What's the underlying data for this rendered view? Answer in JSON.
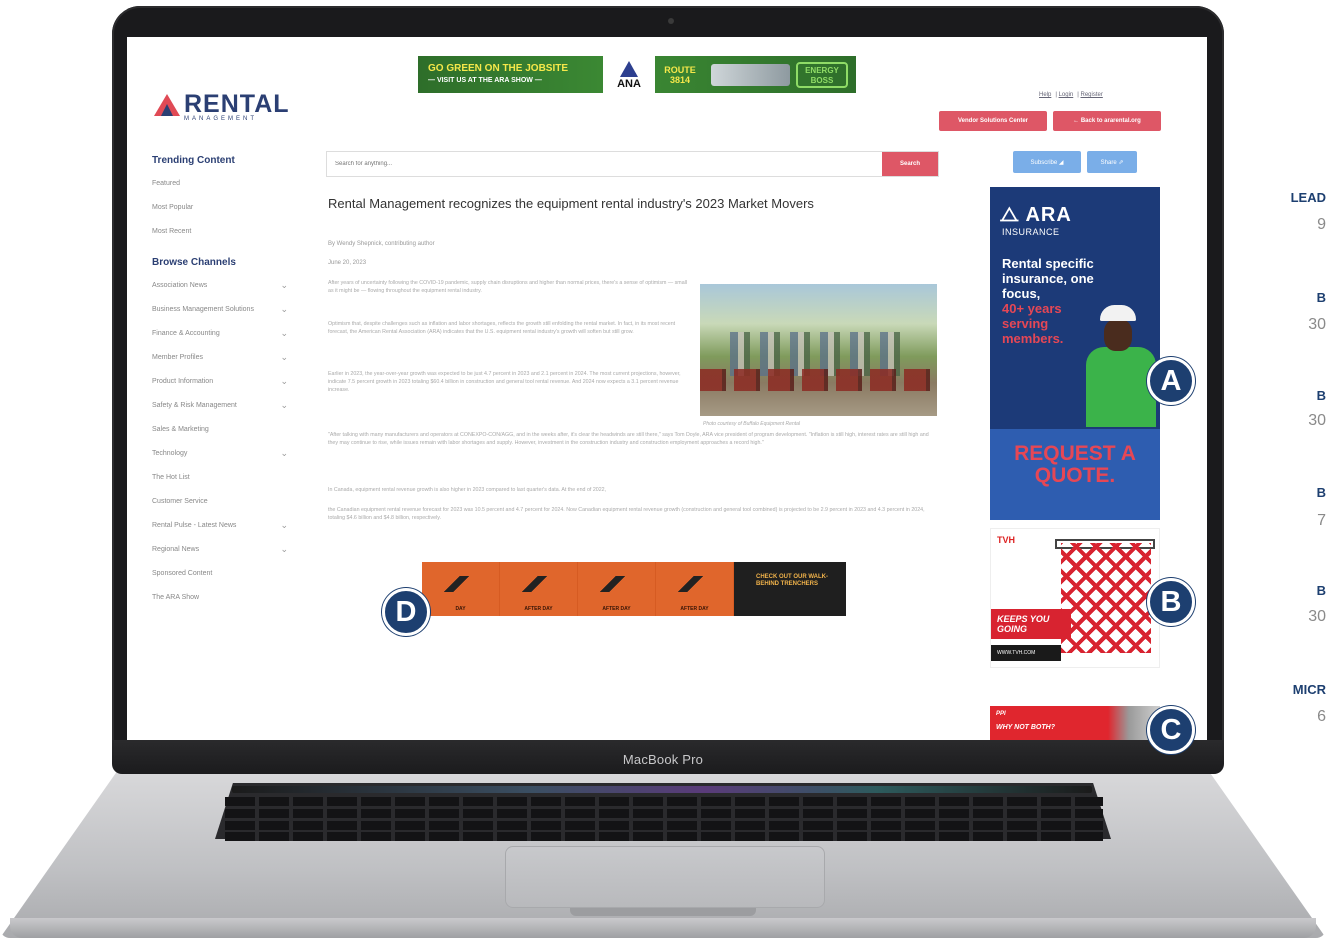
{
  "laptop": {
    "brand_label": "MacBook Pro"
  },
  "site": {
    "top_banner": {
      "headline": "GO GREEN ON THE JOBSITE",
      "subline": "— VISIT US AT THE ARA SHOW —",
      "ana": "ANA",
      "route": "ROUTE 3814",
      "boss": "ENERGY BOSS"
    },
    "logo": {
      "name": "RENTAL",
      "sub": "MANAGEMENT"
    },
    "top_links": [
      "Help",
      "Login",
      "Register"
    ],
    "vendor_button": "Vendor Solutions Center",
    "back_button": "← Back to ararental.org",
    "search": {
      "placeholder": "Search for anything...",
      "button": "Search"
    },
    "subscribe_button": "Subscribe ◢",
    "share_button": "Share ⇗",
    "sidebar": {
      "trending_heading": "Trending Content",
      "trending": [
        "Featured",
        "Most Popular",
        "Most Recent"
      ],
      "browse_heading": "Browse Channels",
      "channels": [
        {
          "label": "Association News",
          "chevron": true
        },
        {
          "label": "Business Management Solutions",
          "chevron": true
        },
        {
          "label": "Finance & Accounting",
          "chevron": true
        },
        {
          "label": "Member Profiles",
          "chevron": true
        },
        {
          "label": "Product Information",
          "chevron": true
        },
        {
          "label": "Safety & Risk Management",
          "chevron": true
        },
        {
          "label": "Sales & Marketing",
          "chevron": false
        },
        {
          "label": "Technology",
          "chevron": true
        },
        {
          "label": "The Hot List",
          "chevron": false
        },
        {
          "label": "Customer Service",
          "chevron": false
        },
        {
          "label": "Rental Pulse - Latest News",
          "chevron": true
        },
        {
          "label": "Regional News",
          "chevron": true
        },
        {
          "label": "Sponsored Content",
          "chevron": false
        },
        {
          "label": "The ARA Show",
          "chevron": false
        }
      ]
    },
    "article": {
      "title": "Rental Management recognizes the equipment rental industry's 2023 Market Movers",
      "byline": "By Wendy Shepnick, contributing author",
      "date": "June 20, 2023",
      "paragraphs": [
        "After years of uncertainty following the COVID-19 pandemic, supply chain disruptions and higher than normal prices, there's a sense of optimism — small as it might be — flowing throughout the equipment rental industry.",
        "Optimism that, despite challenges such as inflation and labor shortages, reflects the growth still enfolding the rental market. In fact, in its most recent forecast, the American Rental Association (ARA) indicates that the U.S. equipment rental industry's growth will soften but still grow.",
        "Earlier in 2023, the year-over-year growth was expected to be just 4.7 percent in 2023 and 2.1 percent in 2024. The most current projections, however, indicate 7.5 percent growth in 2023 totaling $60.4 billion in construction and general tool rental revenue. And 2024 now expects a 3.1 percent revenue increase.",
        "\"After talking with many manufacturers and operators at CONEXPO-CON/AGG, and in the weeks after, it's clear the headwinds are still there,\" says Tom Doyle, ARA vice president of program development. \"Inflation is still high, interest rates are still high and they may continue to rise, while issues remain with labor shortages and supply. However, investment in the construction industry and construction employment approaches a record high.\"",
        "In Canada, equipment rental revenue growth is also higher in 2023 compared to last quarter's data. At the end of 2022,",
        "the Canadian equipment rental revenue forecast for 2023 was 10.5 percent and 4.7 percent for 2024. Now Canadian equipment rental revenue growth (construction and general tool combined) is projected to be 2.9 percent in 2023 and 4.3 percent in 2024, totaling $4.6 billion and $4.8 billion, respectively."
      ],
      "photo_caption": "Photo courtesy of Buffalo Equipment Rental"
    },
    "bottom_ad": {
      "cells": [
        "DAY",
        "AFTER DAY",
        "AFTER DAY",
        "AFTER DAY"
      ],
      "cta": "CHECK OUT OUR WALK-BEHIND TRENCHERS"
    },
    "ad_a": {
      "brand": "ARA",
      "brand_sub": "INSURANCE",
      "copy": "Rental specific insurance, one focus,",
      "highlight": "40+ years serving members.",
      "cta": "REQUEST A QUOTE."
    },
    "ad_b": {
      "brand": "TVH",
      "tagline": "KEEPS YOU GOING",
      "url": "WWW.TVH.COM"
    },
    "ad_c": {
      "brand": "PPI",
      "tagline": "WHY NOT BOTH?"
    }
  },
  "markers": [
    "A",
    "B",
    "C",
    "D"
  ],
  "right_column": {
    "labels": [
      "LEAD",
      "B",
      "B",
      "B",
      "B",
      "MICR"
    ],
    "numbers": [
      "9",
      "30",
      "30",
      "7",
      "30",
      "6"
    ]
  },
  "colors": {
    "brand_navy": "#2b3f73",
    "brand_red": "#de5766",
    "marker_navy": "#1d3f70",
    "action_blue": "#7aaee8"
  }
}
